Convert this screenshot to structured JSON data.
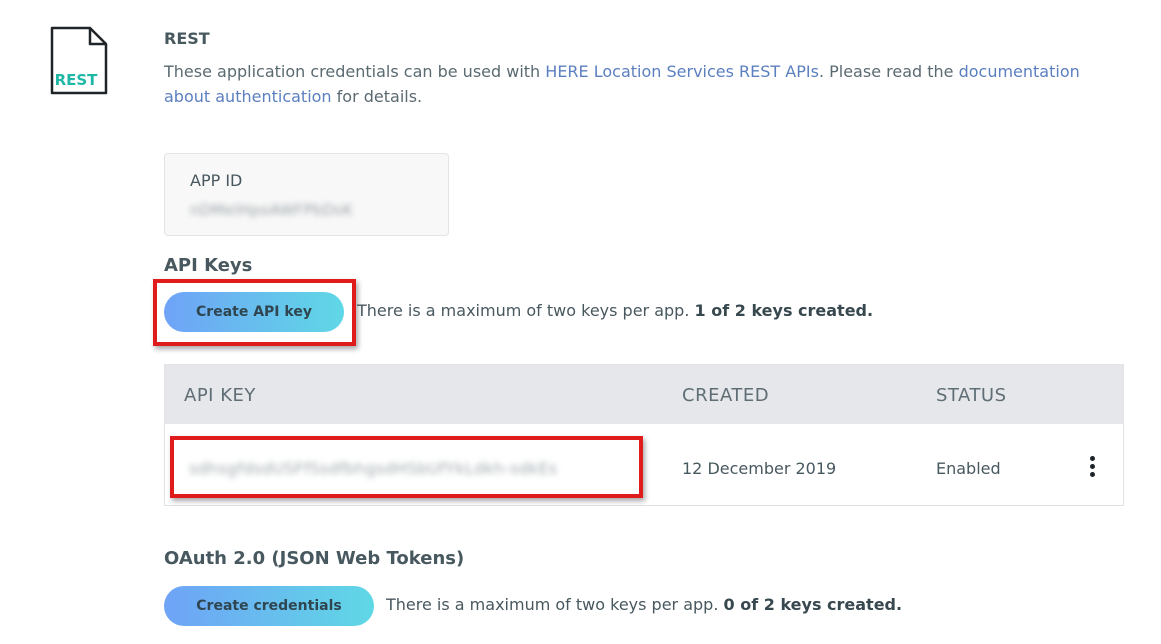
{
  "rest_section": {
    "icon_label": "REST",
    "title": "REST",
    "intro": {
      "text_before": "These application credentials can be used with ",
      "link1": "HERE Location Services REST APIs",
      "text_middle": ". Please read the ",
      "link2": "documentation about authentication",
      "text_after": " for details."
    }
  },
  "app_id": {
    "label": "APP ID",
    "value": "nDMelHpoAWFPbDsK"
  },
  "api_keys": {
    "heading": "API Keys",
    "create_button": "Create API key",
    "hint": "There is a maximum of two keys per app.",
    "count": "1 of 2 keys created.",
    "table": {
      "columns": [
        "API KEY",
        "CREATED",
        "STATUS"
      ],
      "rows": [
        {
          "key": "sdhsgfdsdUSFfSsdfbhgsdHSbUfYkLdkh-sdkEs",
          "created": "12 December 2019",
          "status": "Enabled"
        }
      ]
    }
  },
  "oauth": {
    "heading": "OAuth 2.0 (JSON Web Tokens)",
    "create_button": "Create credentials",
    "hint": "There is a maximum of two keys per app.",
    "count": "0 of 2 keys created."
  },
  "colors": {
    "link": "#5b7fbf",
    "accent_teal": "#1fb7a6",
    "highlight": "#e01b1b",
    "button_gradient_start": "#6fa3f7",
    "button_gradient_end": "#5fd8e5"
  }
}
